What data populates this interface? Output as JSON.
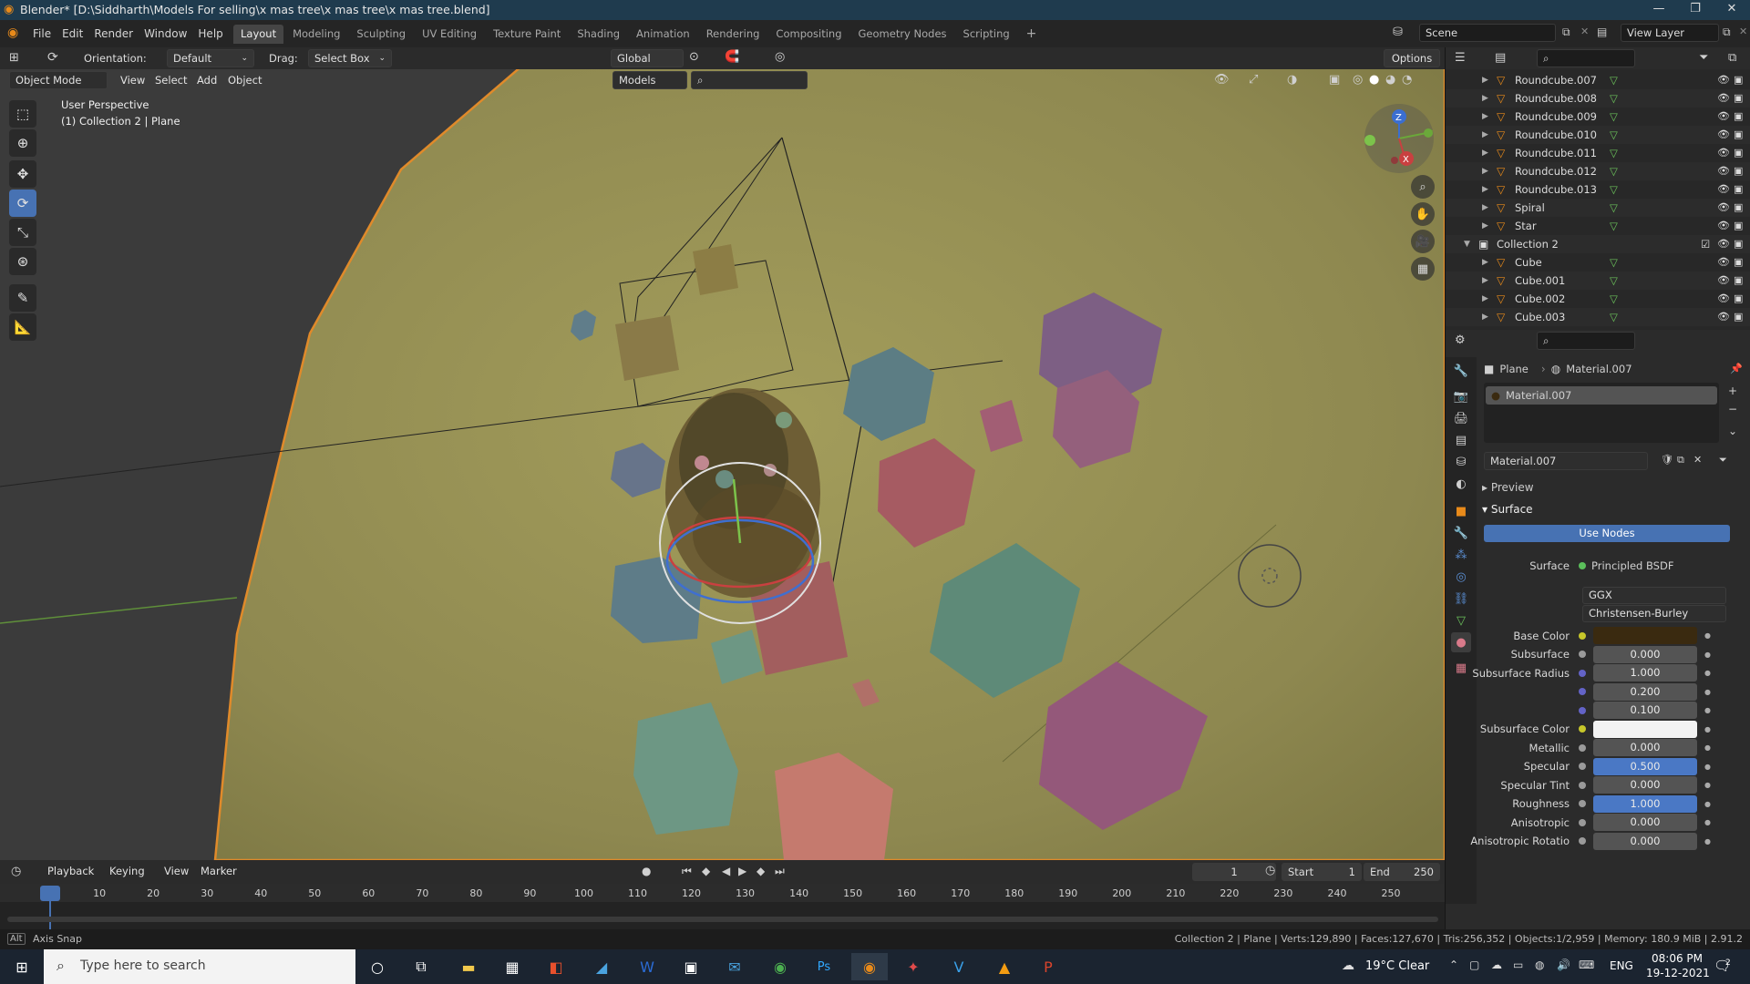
{
  "window": {
    "title": "Blender* [D:\\Siddharth\\Models For selling\\x mas tree\\x mas tree\\x mas tree.blend]",
    "minimize": "—",
    "maximize": "❐",
    "close": "✕"
  },
  "menu": [
    "File",
    "Edit",
    "Render",
    "Window",
    "Help"
  ],
  "workspaces": [
    "Layout",
    "Modeling",
    "Sculpting",
    "UV Editing",
    "Texture Paint",
    "Shading",
    "Animation",
    "Rendering",
    "Compositing",
    "Geometry Nodes",
    "Scripting"
  ],
  "add_workspace": "+",
  "scene": {
    "name": "Scene",
    "view_layer": "View Layer"
  },
  "header2": {
    "orientation_label": "Orientation:",
    "orientation_value": "Default",
    "drag_label": "Drag:",
    "drag_value": "Select Box",
    "transform": "Global",
    "options": "Options"
  },
  "viewport_header": {
    "mode": "Object Mode",
    "view": "View",
    "select": "Select",
    "add": "Add",
    "object": "Object",
    "models_dropdown": "Models"
  },
  "viewport": {
    "perspective": "User Perspective",
    "context": "(1) Collection 2 | Plane",
    "axes": [
      "X",
      "Y",
      "Z"
    ]
  },
  "timeline": {
    "menus": [
      "Playback",
      "Keying",
      "View",
      "Marker"
    ],
    "current_frame": "1",
    "start_label": "Start",
    "start": "1",
    "end_label": "End",
    "end": "250",
    "ticks": [
      "1",
      "10",
      "20",
      "30",
      "40",
      "50",
      "60",
      "70",
      "80",
      "90",
      "100",
      "110",
      "120",
      "130",
      "140",
      "150",
      "160",
      "170",
      "180",
      "190",
      "200",
      "210",
      "220",
      "230",
      "240",
      "250"
    ]
  },
  "status_bar": {
    "left": "Axis Snap",
    "right": "Collection 2 | Plane | Verts:129,890 | Faces:127,670 | Tris:256,352 | Objects:1/2,959 | Memory: 180.9 MiB | 2.91.2"
  },
  "outliner": {
    "items": [
      {
        "name": "Roundcube.007",
        "indent": 2
      },
      {
        "name": "Roundcube.008",
        "indent": 2
      },
      {
        "name": "Roundcube.009",
        "indent": 2
      },
      {
        "name": "Roundcube.010",
        "indent": 2
      },
      {
        "name": "Roundcube.011",
        "indent": 2
      },
      {
        "name": "Roundcube.012",
        "indent": 2
      },
      {
        "name": "Roundcube.013",
        "indent": 2
      },
      {
        "name": "Spiral",
        "indent": 2
      },
      {
        "name": "Star",
        "indent": 2
      },
      {
        "name": "Collection 2",
        "indent": 1
      },
      {
        "name": "Cube",
        "indent": 2
      },
      {
        "name": "Cube.001",
        "indent": 2
      },
      {
        "name": "Cube.002",
        "indent": 2
      },
      {
        "name": "Cube.003",
        "indent": 2
      }
    ]
  },
  "properties": {
    "object": "Plane",
    "material": "Material.007",
    "slot": "Material.007",
    "datablock": "Material.007",
    "preview": "Preview",
    "surface_section": "Surface",
    "use_nodes": "Use Nodes",
    "surface_label": "Surface",
    "surface_value": "Principled BSDF",
    "distribution": "GGX",
    "subsurface_method": "Christensen-Burley",
    "fields": [
      {
        "label": "Base Color",
        "value": "",
        "kind": "color",
        "color": "#3a2a10"
      },
      {
        "label": "Subsurface",
        "value": "0.000",
        "kind": "num"
      },
      {
        "label": "Subsurface Radius",
        "value": "1.000",
        "kind": "num"
      },
      {
        "label": "",
        "value": "0.200",
        "kind": "num"
      },
      {
        "label": "",
        "value": "0.100",
        "kind": "num"
      },
      {
        "label": "Subsurface Color",
        "value": "",
        "kind": "color",
        "color": "#f2f2f2"
      },
      {
        "label": "Metallic",
        "value": "0.000",
        "kind": "num"
      },
      {
        "label": "Specular",
        "value": "0.500",
        "kind": "blue"
      },
      {
        "label": "Specular Tint",
        "value": "0.000",
        "kind": "num"
      },
      {
        "label": "Roughness",
        "value": "1.000",
        "kind": "blue"
      },
      {
        "label": "Anisotropic",
        "value": "0.000",
        "kind": "num"
      },
      {
        "label": "Anisotropic Rotatio",
        "value": "0.000",
        "kind": "num"
      }
    ]
  },
  "taskbar": {
    "search_placeholder": "Type here to search",
    "weather": "19°C  Clear",
    "lang": "ENG",
    "time": "08:06 PM",
    "date": "19-12-2021",
    "notification_count": "2"
  }
}
